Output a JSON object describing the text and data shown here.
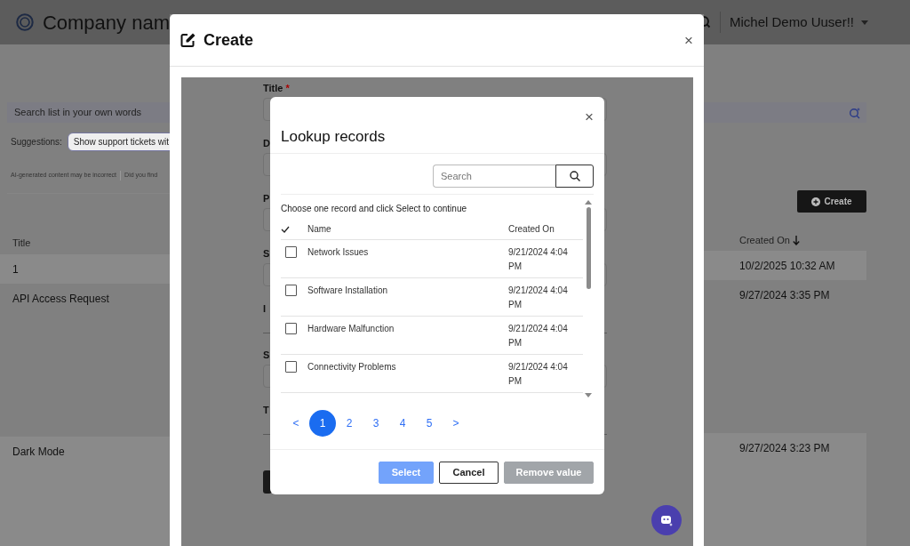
{
  "header": {
    "company": "Company nam",
    "user": "Michel Demo Uuser!!"
  },
  "search": {
    "placeholder": "Search list in your own words"
  },
  "suggestions": {
    "label": "Suggestions:",
    "chips": [
      "Show support tickets wit"
    ]
  },
  "disclaimer": [
    "AI-generated content may be incorrect",
    "Did you find"
  ],
  "create_button": "Create",
  "list": {
    "columns": [
      "Title",
      "Created On"
    ],
    "rows": [
      {
        "title": "1",
        "created": "10/2/2025 10:32 AM"
      },
      {
        "title": "API Access Request",
        "created": "9/27/2024 3:35 PM"
      },
      {
        "title": "Dark Mode",
        "created": "9/27/2024 3:23 PM"
      }
    ]
  },
  "create_modal": {
    "title": "Create",
    "close": "×",
    "fields": [
      {
        "label": "Title",
        "marker": "*",
        "kind": "box"
      },
      {
        "label": "D",
        "kind": "box"
      },
      {
        "label": "P",
        "kind": "box"
      },
      {
        "label": "S",
        "kind": "box"
      },
      {
        "label": "I",
        "kind": "line"
      },
      {
        "label": "S",
        "kind": "box"
      },
      {
        "label": "T",
        "kind": "line"
      }
    ]
  },
  "lookup": {
    "title": "Lookup records",
    "close": "×",
    "search": {
      "placeholder": "Search"
    },
    "instruction": "Choose one record and click Select to continue",
    "columns": [
      "Name",
      "Created On"
    ],
    "rows": [
      {
        "name": "Network Issues",
        "created": "9/21/2024 4:04 PM",
        "checked": false
      },
      {
        "name": "Software Installation",
        "created": "9/21/2024 4:04 PM",
        "checked": false
      },
      {
        "name": "Hardware Malfunction",
        "created": "9/21/2024 4:04 PM",
        "checked": false
      },
      {
        "name": "Connectivity Problems",
        "created": "9/21/2024 4:04 PM",
        "checked": false
      }
    ],
    "pages": [
      {
        "label": "<",
        "selected": false
      },
      {
        "label": "1",
        "selected": true
      },
      {
        "label": "2",
        "selected": false
      },
      {
        "label": "3",
        "selected": false
      },
      {
        "label": "4",
        "selected": false
      },
      {
        "label": "5",
        "selected": false
      },
      {
        "label": ">",
        "selected": false
      }
    ],
    "buttons": [
      {
        "label": "Select",
        "kind": "primary",
        "disabled": true
      },
      {
        "label": "Cancel",
        "kind": "outline",
        "disabled": false
      },
      {
        "label": "Remove value",
        "kind": "secondary",
        "disabled": true
      }
    ]
  }
}
